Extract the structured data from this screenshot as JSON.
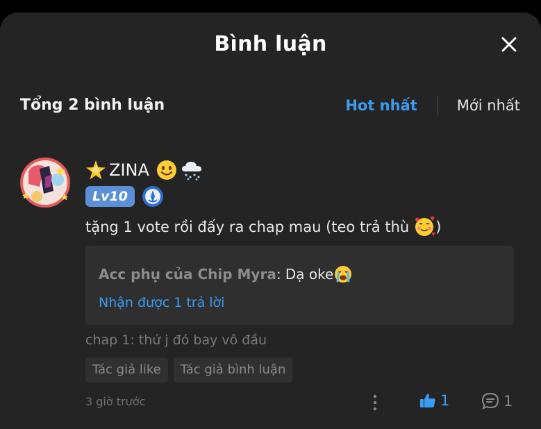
{
  "header": {
    "title": "Bình luận"
  },
  "toolbar": {
    "total": "Tổng 2 bình luận",
    "sort_hot": "Hot nhất",
    "sort_new": "Mới nhất"
  },
  "comment": {
    "username": "ZINA",
    "level": "Lv10",
    "text": "tặng 1 vote rồi đấy ra chap mau (teo trả thù",
    "reply": {
      "author": "Acc phụ của Chip Myra",
      "text": ": Dạ oke",
      "more": "Nhận được 1 trả lời"
    },
    "chapter": "chap 1: thứ j đó bay vô đầu",
    "tags": [
      "Tác giả like",
      "Tác giả bình luận"
    ],
    "time": "3 giờ trước",
    "likes": "1",
    "replies": "1"
  },
  "colors": {
    "accent": "#3b9cf3",
    "sheet_bg": "#242424",
    "level_badge": "#5b8fd6"
  }
}
